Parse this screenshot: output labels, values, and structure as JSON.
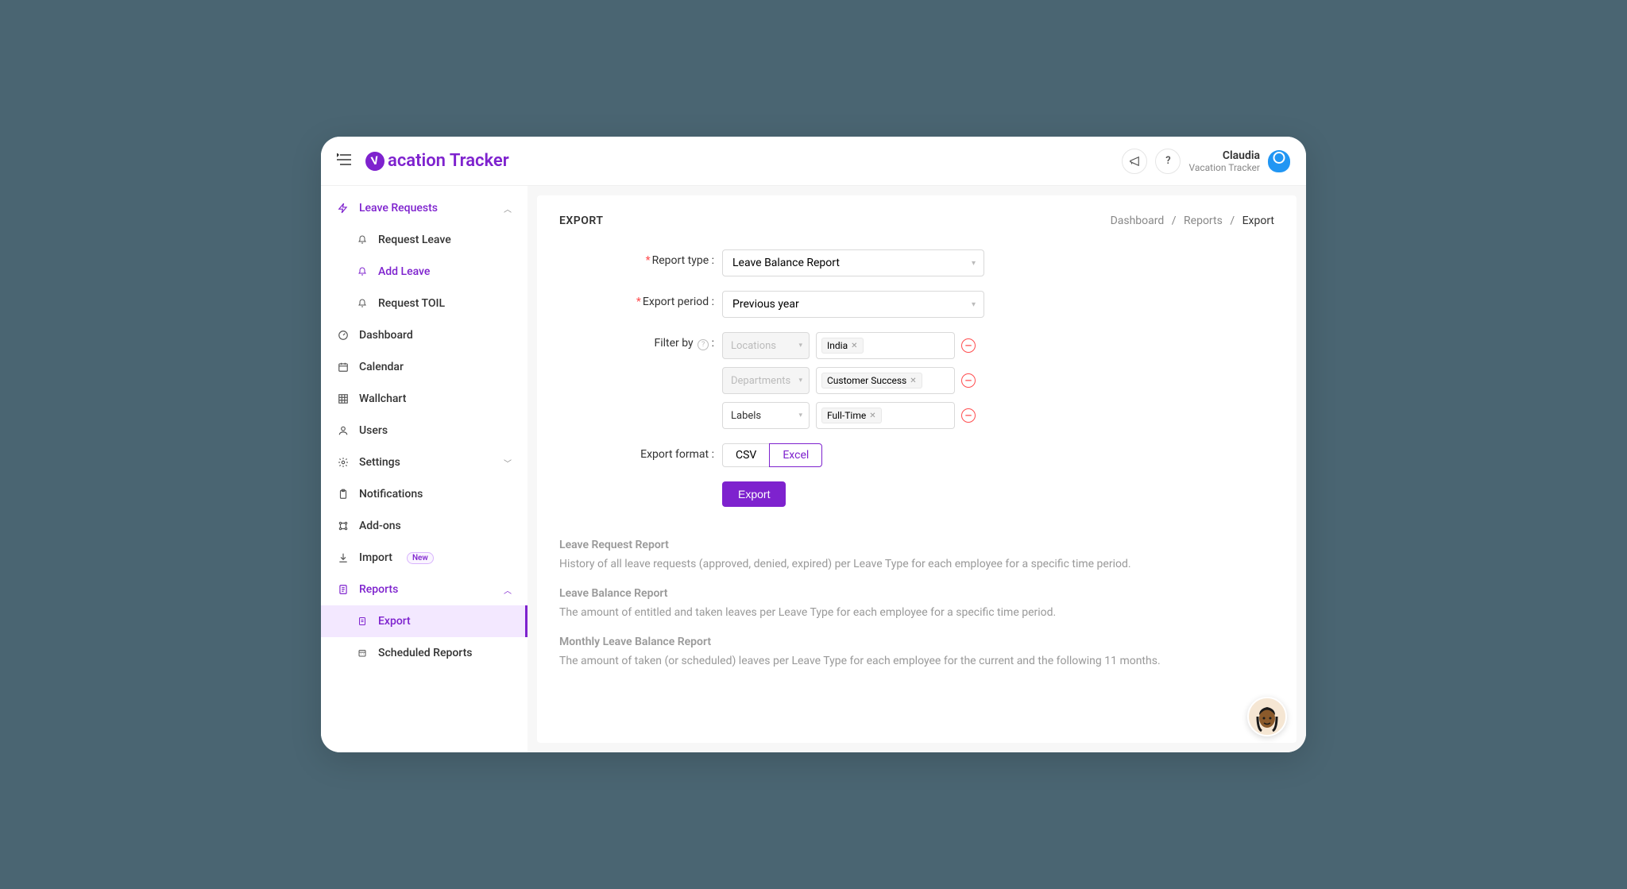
{
  "app": {
    "name": "acation Tracker",
    "logo_letter": "V"
  },
  "header": {
    "user_name": "Claudia",
    "user_org": "Vacation Tracker"
  },
  "sidebar": {
    "leave_requests": {
      "label": "Leave Requests"
    },
    "request_leave": {
      "label": "Request Leave"
    },
    "add_leave": {
      "label": "Add Leave"
    },
    "request_toil": {
      "label": "Request TOIL"
    },
    "dashboard": {
      "label": "Dashboard"
    },
    "calendar": {
      "label": "Calendar"
    },
    "wallchart": {
      "label": "Wallchart"
    },
    "users": {
      "label": "Users"
    },
    "settings": {
      "label": "Settings"
    },
    "notifications": {
      "label": "Notifications"
    },
    "addons": {
      "label": "Add-ons"
    },
    "import": {
      "label": "Import",
      "badge": "New"
    },
    "reports": {
      "label": "Reports"
    },
    "export": {
      "label": "Export"
    },
    "scheduled_reports": {
      "label": "Scheduled Reports"
    }
  },
  "page": {
    "title": "EXPORT",
    "breadcrumb": {
      "p0": "Dashboard",
      "p1": "Reports",
      "p2": "Export"
    }
  },
  "form": {
    "report_type": {
      "label": "Report type",
      "value": "Leave Balance Report"
    },
    "export_period": {
      "label": "Export period",
      "value": "Previous year"
    },
    "filter_by": {
      "label": "Filter by",
      "rows": [
        {
          "type": "Locations",
          "tag": "India",
          "disabled": true
        },
        {
          "type": "Departments",
          "tag": "Customer Success",
          "disabled": true
        },
        {
          "type": "Labels",
          "tag": "Full-Time",
          "disabled": false
        }
      ]
    },
    "export_format": {
      "label": "Export format",
      "opt_csv": "CSV",
      "opt_excel": "Excel"
    },
    "submit": "Export"
  },
  "descriptions": [
    {
      "title": "Leave Request Report",
      "text": "History of all leave requests (approved, denied, expired) per Leave Type for each employee for a specific time period."
    },
    {
      "title": "Leave Balance Report",
      "text": "The amount of entitled and taken leaves per Leave Type for each employee for a specific time period."
    },
    {
      "title": "Monthly Leave Balance Report",
      "text": "The amount of taken (or scheduled) leaves per Leave Type for each employee for the current and the following 11 months."
    }
  ]
}
